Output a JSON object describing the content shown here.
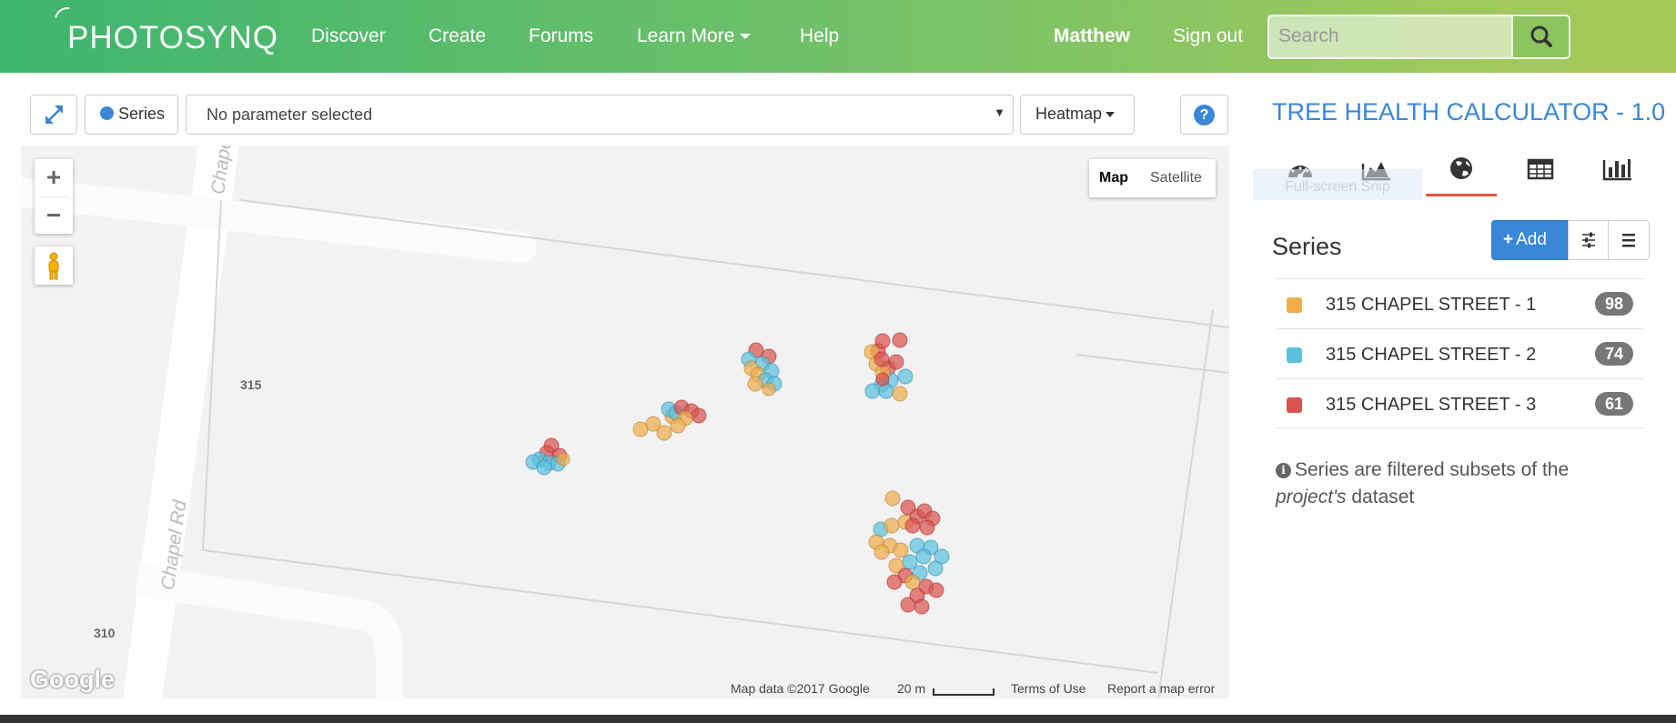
{
  "navbar": {
    "brand": "PHOTOSYNQ",
    "items": [
      {
        "label": "Discover"
      },
      {
        "label": "Create"
      },
      {
        "label": "Forums"
      },
      {
        "label": "Learn More"
      },
      {
        "label": "Help"
      }
    ],
    "user": "Matthew",
    "signout": "Sign out",
    "search_placeholder": "Search"
  },
  "toolbar": {
    "series_label": "Series",
    "parameter_value": "No parameter selected",
    "view_mode": "Heatmap",
    "series_color": "#3a87d6"
  },
  "map": {
    "map_label": "Map",
    "satellite_label": "Satellite",
    "labels": {
      "address_315": "315",
      "address_310": "310",
      "road_north": "Chapel R",
      "road_south": "Chapel Rd"
    },
    "logo": "Google",
    "footer": {
      "map_data": "Map data ©2017 Google",
      "scale": "20 m",
      "terms": "Terms of Use",
      "report": "Report a map error"
    }
  },
  "panel": {
    "project_title": "TREE HEALTH CALCULATOR - 1.0",
    "tabs": [
      {
        "icon": "dashboard-icon"
      },
      {
        "icon": "area-chart-icon"
      },
      {
        "icon": "globe-icon",
        "active": true
      },
      {
        "icon": "table-icon"
      },
      {
        "icon": "bar-chart-icon"
      }
    ],
    "snip_overlay": "Full-screen Snip",
    "series_heading": "Series",
    "add_label": "Add",
    "series": [
      {
        "name": "315 CHAPEL STREET - 1",
        "count": "98",
        "color": "#f0ad4e"
      },
      {
        "name": "315 CHAPEL STREET - 2",
        "count": "74",
        "color": "#5bc0de"
      },
      {
        "name": "315 CHAPEL STREET - 3",
        "count": "61",
        "color": "#d9534f"
      }
    ],
    "info": {
      "before": "Series are filtered subsets of the ",
      "emphasis": "project's",
      "after": " dataset"
    }
  }
}
